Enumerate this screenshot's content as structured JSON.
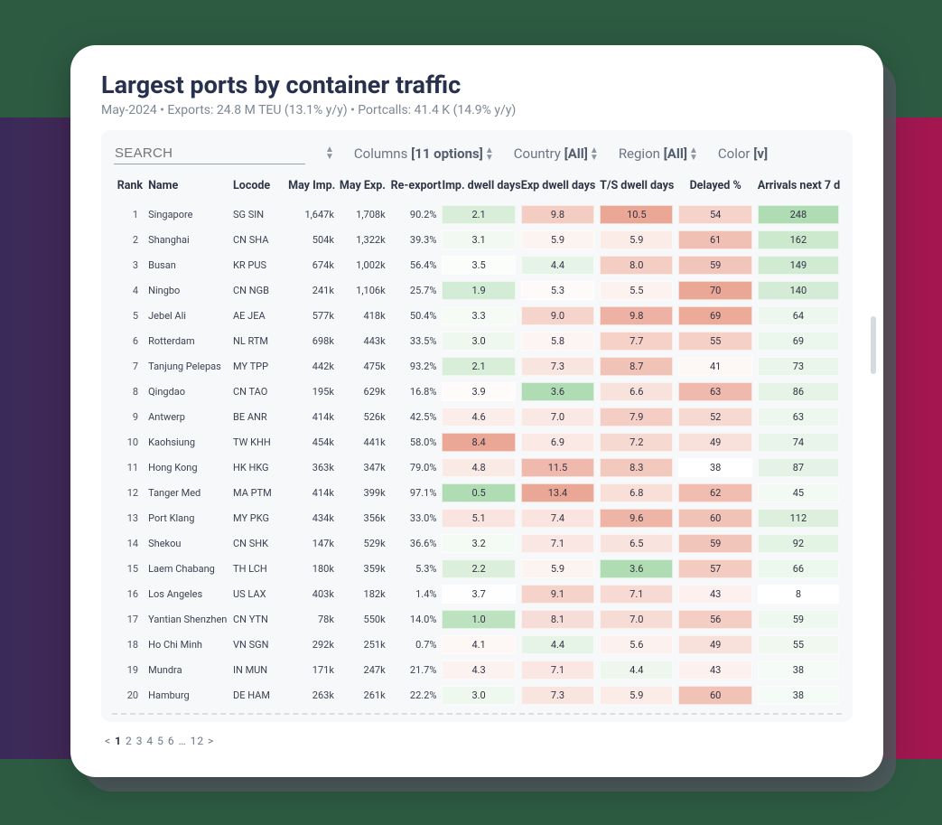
{
  "header": {
    "title": "Largest ports by container traffic",
    "subtitle": "May-2024 • Exports: 24.8 M TEU (13.1% y/y) • Portcalls: 41.4 K (14.9% y/y)"
  },
  "controls": {
    "search_placeholder": "SEARCH",
    "columns": {
      "label": "Columns",
      "value": "[11 options]"
    },
    "country": {
      "label": "Country",
      "value": "[All]"
    },
    "region": {
      "label": "Region",
      "value": "[All]"
    },
    "color": {
      "label": "Color",
      "value": "[v]"
    }
  },
  "columns": [
    "Rank",
    "Name",
    "Locode",
    "May Imp.",
    "May Exp.",
    "Re-export",
    "Imp. dwell days",
    "Exp dwell days",
    "T/S dwell days",
    "Delayed %",
    "Arrivals next 7 d"
  ],
  "col_align": [
    "r",
    "l",
    "l",
    "r",
    "r",
    "r",
    "c",
    "c",
    "c",
    "c",
    "c"
  ],
  "heat_cols": [
    6,
    7,
    8,
    9,
    10
  ],
  "heat_palette": {
    "red": {
      "min": "#fbeeec",
      "mid": "#f2c6bd",
      "max": "#eba796"
    },
    "green": {
      "min": "#f4faf4",
      "mid": "#d4ecd4",
      "max": "#b0dcb3"
    }
  },
  "rows": [
    {
      "rank": 1,
      "name": "Singapore",
      "locode": "SG SIN",
      "imp": "1,647k",
      "exp": "1,708k",
      "rex": "90.2%",
      "imp_d": 2.1,
      "exp_d": 9.8,
      "ts_d": 10.5,
      "delayed": 54,
      "arr": 248
    },
    {
      "rank": 2,
      "name": "Shanghai",
      "locode": "CN SHA",
      "imp": "504k",
      "exp": "1,322k",
      "rex": "39.3%",
      "imp_d": 3.1,
      "exp_d": 5.9,
      "ts_d": 5.9,
      "delayed": 61,
      "arr": 162
    },
    {
      "rank": 3,
      "name": "Busan",
      "locode": "KR PUS",
      "imp": "674k",
      "exp": "1,002k",
      "rex": "56.4%",
      "imp_d": 3.5,
      "exp_d": 4.4,
      "ts_d": 8.0,
      "delayed": 59,
      "arr": 149
    },
    {
      "rank": 4,
      "name": "Ningbo",
      "locode": "CN NGB",
      "imp": "241k",
      "exp": "1,106k",
      "rex": "25.7%",
      "imp_d": 1.9,
      "exp_d": 5.3,
      "ts_d": 5.5,
      "delayed": 70,
      "arr": 140
    },
    {
      "rank": 5,
      "name": "Jebel Ali",
      "locode": "AE JEA",
      "imp": "577k",
      "exp": "418k",
      "rex": "50.4%",
      "imp_d": 3.3,
      "exp_d": 9.0,
      "ts_d": 9.8,
      "delayed": 69,
      "arr": 64
    },
    {
      "rank": 6,
      "name": "Rotterdam",
      "locode": "NL RTM",
      "imp": "698k",
      "exp": "443k",
      "rex": "33.5%",
      "imp_d": 3.0,
      "exp_d": 5.8,
      "ts_d": 7.7,
      "delayed": 55,
      "arr": 69
    },
    {
      "rank": 7,
      "name": "Tanjung Pelepas",
      "locode": "MY TPP",
      "imp": "442k",
      "exp": "475k",
      "rex": "93.2%",
      "imp_d": 2.1,
      "exp_d": 7.3,
      "ts_d": 8.7,
      "delayed": 41,
      "arr": 73
    },
    {
      "rank": 8,
      "name": "Qingdao",
      "locode": "CN TAO",
      "imp": "195k",
      "exp": "629k",
      "rex": "16.8%",
      "imp_d": 3.9,
      "exp_d": 3.6,
      "ts_d": 6.6,
      "delayed": 63,
      "arr": 86
    },
    {
      "rank": 9,
      "name": "Antwerp",
      "locode": "BE ANR",
      "imp": "414k",
      "exp": "526k",
      "rex": "42.5%",
      "imp_d": 4.6,
      "exp_d": 7.0,
      "ts_d": 7.9,
      "delayed": 52,
      "arr": 63
    },
    {
      "rank": 10,
      "name": "Kaohsiung",
      "locode": "TW KHH",
      "imp": "454k",
      "exp": "441k",
      "rex": "58.0%",
      "imp_d": 8.4,
      "exp_d": 6.9,
      "ts_d": 7.2,
      "delayed": 49,
      "arr": 74
    },
    {
      "rank": 11,
      "name": "Hong Kong",
      "locode": "HK HKG",
      "imp": "363k",
      "exp": "347k",
      "rex": "79.0%",
      "imp_d": 4.8,
      "exp_d": 11.5,
      "ts_d": 8.3,
      "delayed": 38,
      "arr": 87
    },
    {
      "rank": 12,
      "name": "Tanger Med",
      "locode": "MA PTM",
      "imp": "414k",
      "exp": "399k",
      "rex": "97.1%",
      "imp_d": 0.5,
      "exp_d": 13.4,
      "ts_d": 6.8,
      "delayed": 62,
      "arr": 45
    },
    {
      "rank": 13,
      "name": "Port Klang",
      "locode": "MY PKG",
      "imp": "434k",
      "exp": "356k",
      "rex": "33.0%",
      "imp_d": 5.1,
      "exp_d": 7.4,
      "ts_d": 9.6,
      "delayed": 60,
      "arr": 112
    },
    {
      "rank": 14,
      "name": "Shekou",
      "locode": "CN SHK",
      "imp": "147k",
      "exp": "529k",
      "rex": "36.6%",
      "imp_d": 3.2,
      "exp_d": 7.1,
      "ts_d": 6.5,
      "delayed": 59,
      "arr": 92
    },
    {
      "rank": 15,
      "name": "Laem Chabang",
      "locode": "TH LCH",
      "imp": "180k",
      "exp": "359k",
      "rex": "5.3%",
      "imp_d": 2.2,
      "exp_d": 5.9,
      "ts_d": 3.6,
      "delayed": 57,
      "arr": 66
    },
    {
      "rank": 16,
      "name": "Los Angeles",
      "locode": "US LAX",
      "imp": "403k",
      "exp": "182k",
      "rex": "1.4%",
      "imp_d": 3.7,
      "exp_d": 9.1,
      "ts_d": 7.1,
      "delayed": 43,
      "arr": 8
    },
    {
      "rank": 17,
      "name": "Yantian Shenzhen",
      "locode": "CN YTN",
      "imp": "78k",
      "exp": "550k",
      "rex": "14.0%",
      "imp_d": 1.0,
      "exp_d": 8.1,
      "ts_d": 7.0,
      "delayed": 56,
      "arr": 59
    },
    {
      "rank": 18,
      "name": "Ho Chi Minh",
      "locode": "VN SGN",
      "imp": "292k",
      "exp": "251k",
      "rex": "0.7%",
      "imp_d": 4.1,
      "exp_d": 4.4,
      "ts_d": 5.6,
      "delayed": 49,
      "arr": 55
    },
    {
      "rank": 19,
      "name": "Mundra",
      "locode": "IN MUN",
      "imp": "171k",
      "exp": "247k",
      "rex": "21.7%",
      "imp_d": 4.3,
      "exp_d": 7.1,
      "ts_d": 4.4,
      "delayed": 43,
      "arr": 38
    },
    {
      "rank": 20,
      "name": "Hamburg",
      "locode": "DE HAM",
      "imp": "263k",
      "exp": "261k",
      "rex": "22.2%",
      "imp_d": 3.0,
      "exp_d": 7.3,
      "ts_d": 5.9,
      "delayed": 60,
      "arr": 38
    }
  ],
  "heat_ranges": {
    "imp_d": {
      "lo": 0.5,
      "hi": 8.4,
      "scheme": "pos-green"
    },
    "exp_d": {
      "lo": 3.6,
      "hi": 13.4,
      "scheme": "pos-red"
    },
    "ts_d": {
      "lo": 3.6,
      "hi": 10.5,
      "scheme": "pos-red"
    },
    "delayed": {
      "lo": 38,
      "hi": 70,
      "scheme": "pos-red"
    },
    "arr": {
      "lo": 8,
      "hi": 248,
      "scheme": "pos-green"
    }
  },
  "pager": {
    "prev": "<",
    "current": "1",
    "rest": " 2  3  4  5  6  …  12 ",
    "next": ">"
  }
}
